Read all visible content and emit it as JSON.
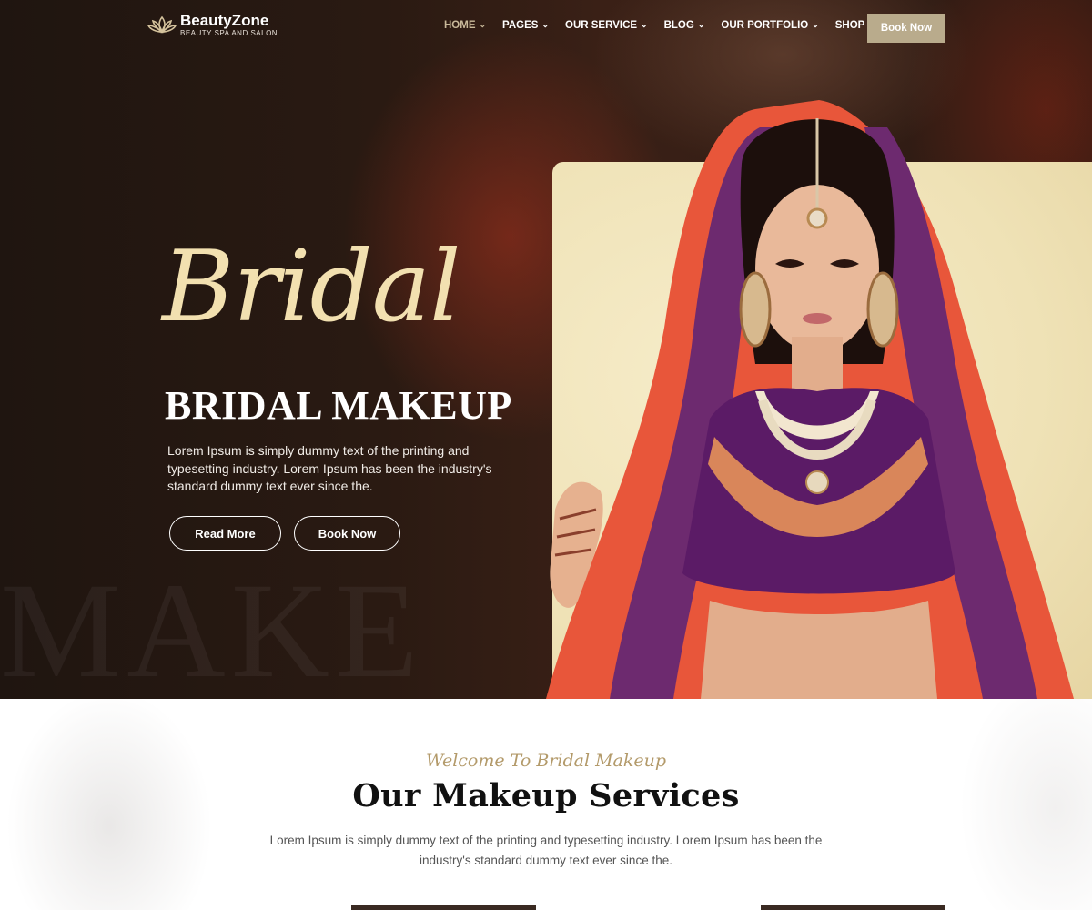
{
  "header": {
    "logo_name": "BeautyZone",
    "logo_tagline": "BEAUTY SPA AND SALON",
    "nav": [
      {
        "label": "HOME",
        "active": true
      },
      {
        "label": "PAGES",
        "active": false
      },
      {
        "label": "OUR SERVICE",
        "active": false
      },
      {
        "label": "BLOG",
        "active": false
      },
      {
        "label": "OUR PORTFOLIO",
        "active": false
      },
      {
        "label": "SHOP",
        "active": false
      }
    ],
    "book_button": "Book Now"
  },
  "hero": {
    "script_title": "Bridal",
    "title": "BRIDAL MAKEUP",
    "description": "Lorem Ipsum is simply dummy text of the printing and typesetting industry. Lorem Ipsum has been the industry's standard dummy text ever since the.",
    "read_more": "Read More",
    "book_now": "Book Now",
    "ghost_text": "MAKE"
  },
  "services": {
    "subtitle": "Welcome To Bridal Makeup",
    "title": "Our Makeup Services",
    "description": "Lorem Ipsum is simply dummy text of the printing and typesetting industry. Lorem Ipsum has been the industry's standard dummy text ever since the."
  },
  "colors": {
    "accent": "#b9ab8c",
    "script_gold": "#f2e0b0",
    "subtitle_gold": "#b39a6a",
    "hero_bg": "#2a1a12"
  },
  "icons": {
    "logo": "lotus-icon",
    "nav_dropdown": "chevron-down-icon"
  }
}
